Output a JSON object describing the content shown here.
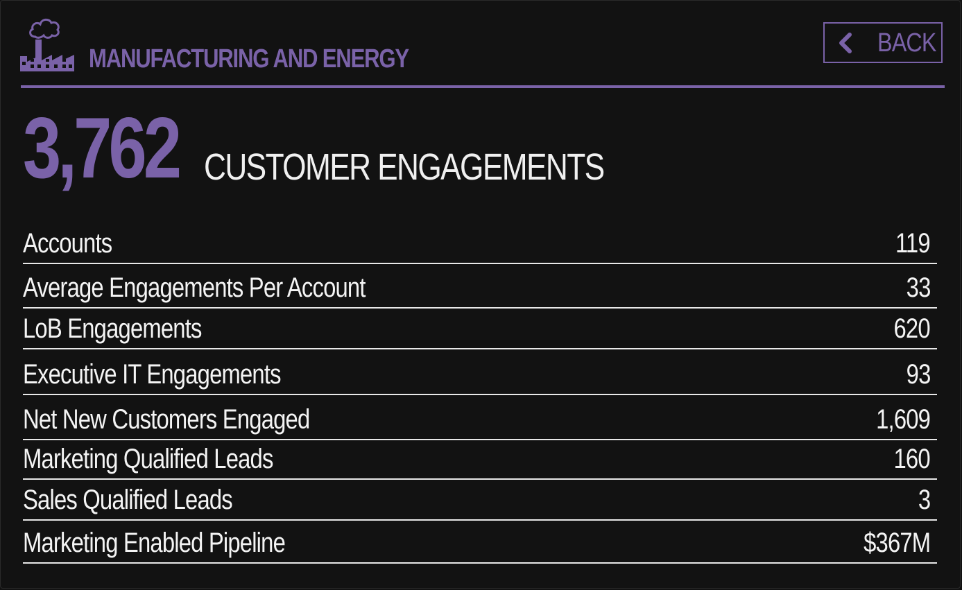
{
  "header": {
    "icon": "factory-icon",
    "title": "MANUFACTURING AND ENERGY",
    "back_label": "BACK",
    "back_icon": "chevron-left-icon"
  },
  "hero": {
    "value": "3,762",
    "label": "CUSTOMER ENGAGEMENTS"
  },
  "stats": [
    {
      "label": "Accounts",
      "value": "119"
    },
    {
      "label": "Average Engagements Per Account",
      "value": "33"
    },
    {
      "label": "LoB Engagements",
      "value": "620"
    },
    {
      "label": "Executive IT Engagements",
      "value": "93"
    },
    {
      "label": "Net New Customers Engaged",
      "value": "1,609"
    },
    {
      "label": "Marketing Qualified Leads",
      "value": "160"
    },
    {
      "label": "Sales Qualified Leads",
      "value": "3"
    },
    {
      "label": "Marketing Enabled Pipeline",
      "value": "$367M"
    }
  ],
  "colors": {
    "accent": "#7a62a8",
    "background": "#121212",
    "text": "#f0f0f0"
  }
}
